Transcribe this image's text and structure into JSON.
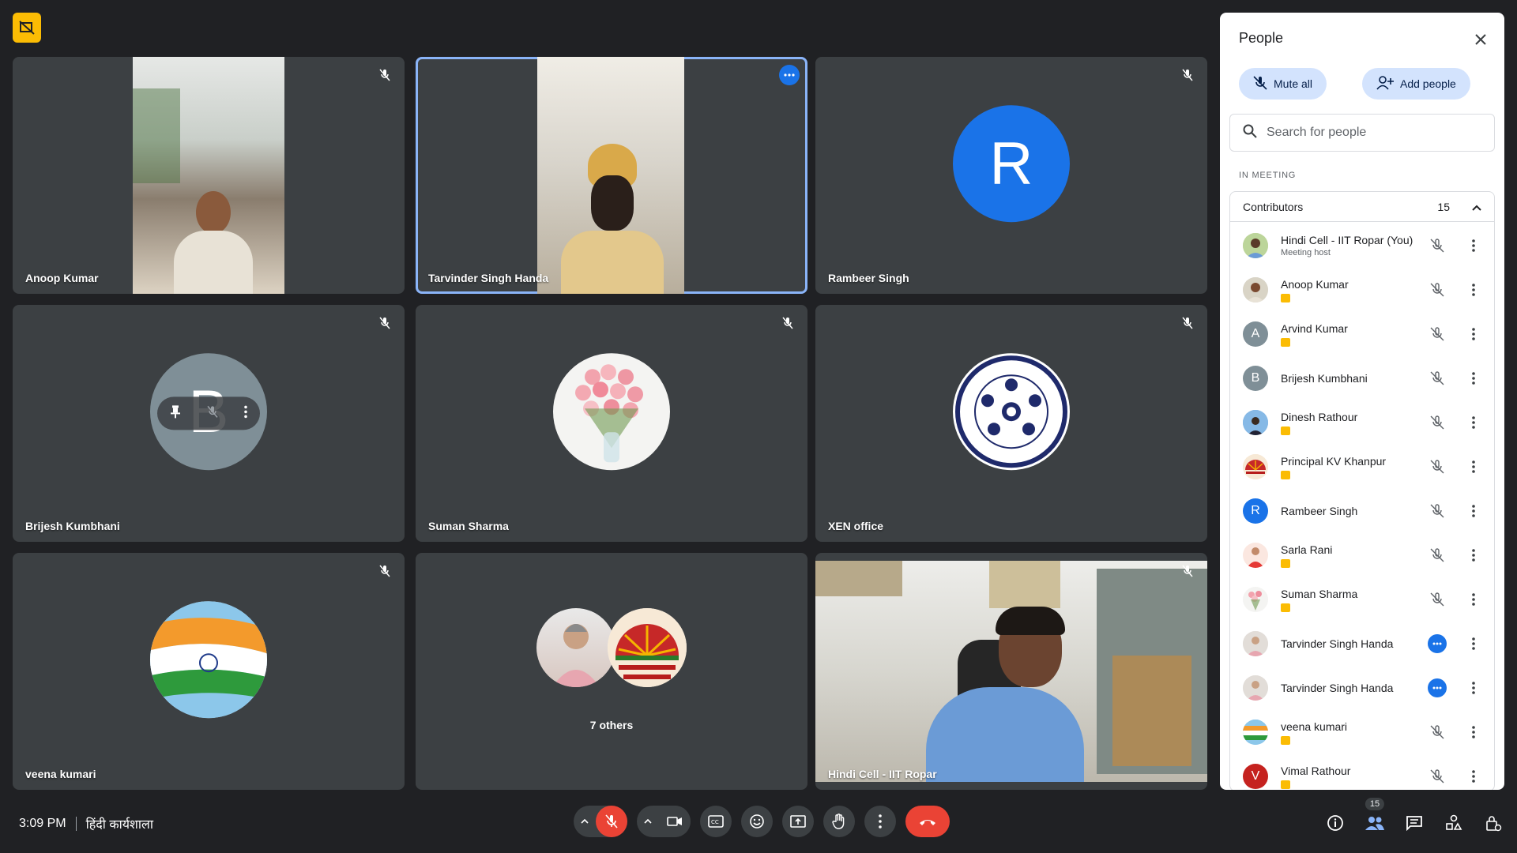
{
  "tiles": [
    {
      "name": "Anoop Kumar"
    },
    {
      "name": "Tarvinder Singh Handa"
    },
    {
      "name": "Rambeer Singh",
      "letter": "R"
    },
    {
      "name": "Brijesh Kumbhani",
      "letter": "B"
    },
    {
      "name": "Suman Sharma"
    },
    {
      "name": "XEN office"
    },
    {
      "name": "veena kumari"
    },
    {
      "name": "",
      "others_label": "7 others"
    },
    {
      "name": "Hindi Cell - IIT Ropar"
    }
  ],
  "bottombar": {
    "time": "3:09 PM",
    "meeting_title": "हिंदी कार्यशाला",
    "people_count": "15"
  },
  "panel": {
    "title": "People",
    "mute_all": "Mute all",
    "add_people": "Add people",
    "search_placeholder": "Search for people",
    "section_label": "IN MEETING",
    "group_label": "Contributors",
    "group_count": "15",
    "participants": [
      {
        "name": "Hindi Cell - IIT Ropar (You)",
        "sub": "Meeting host"
      },
      {
        "name": "Anoop Kumar"
      },
      {
        "name": "Arvind Kumar",
        "letter": "A"
      },
      {
        "name": "Brijesh Kumbhani",
        "letter": "B"
      },
      {
        "name": "Dinesh Rathour"
      },
      {
        "name": "Principal KV Khanpur"
      },
      {
        "name": "Rambeer Singh",
        "letter": "R"
      },
      {
        "name": "Sarla Rani"
      },
      {
        "name": "Suman Sharma"
      },
      {
        "name": "Tarvinder Singh Handa"
      },
      {
        "name": "Tarvinder Singh Handa"
      },
      {
        "name": "veena kumari"
      },
      {
        "name": "Vimal Rathour",
        "letter": "V"
      }
    ]
  },
  "colors": {
    "accent": "#1a73e8",
    "end_call": "#ea4335",
    "recording": "#fbbc04",
    "rambeer_avatar": "#1a73e8",
    "brijesh_avatar": "#7f8f97"
  }
}
